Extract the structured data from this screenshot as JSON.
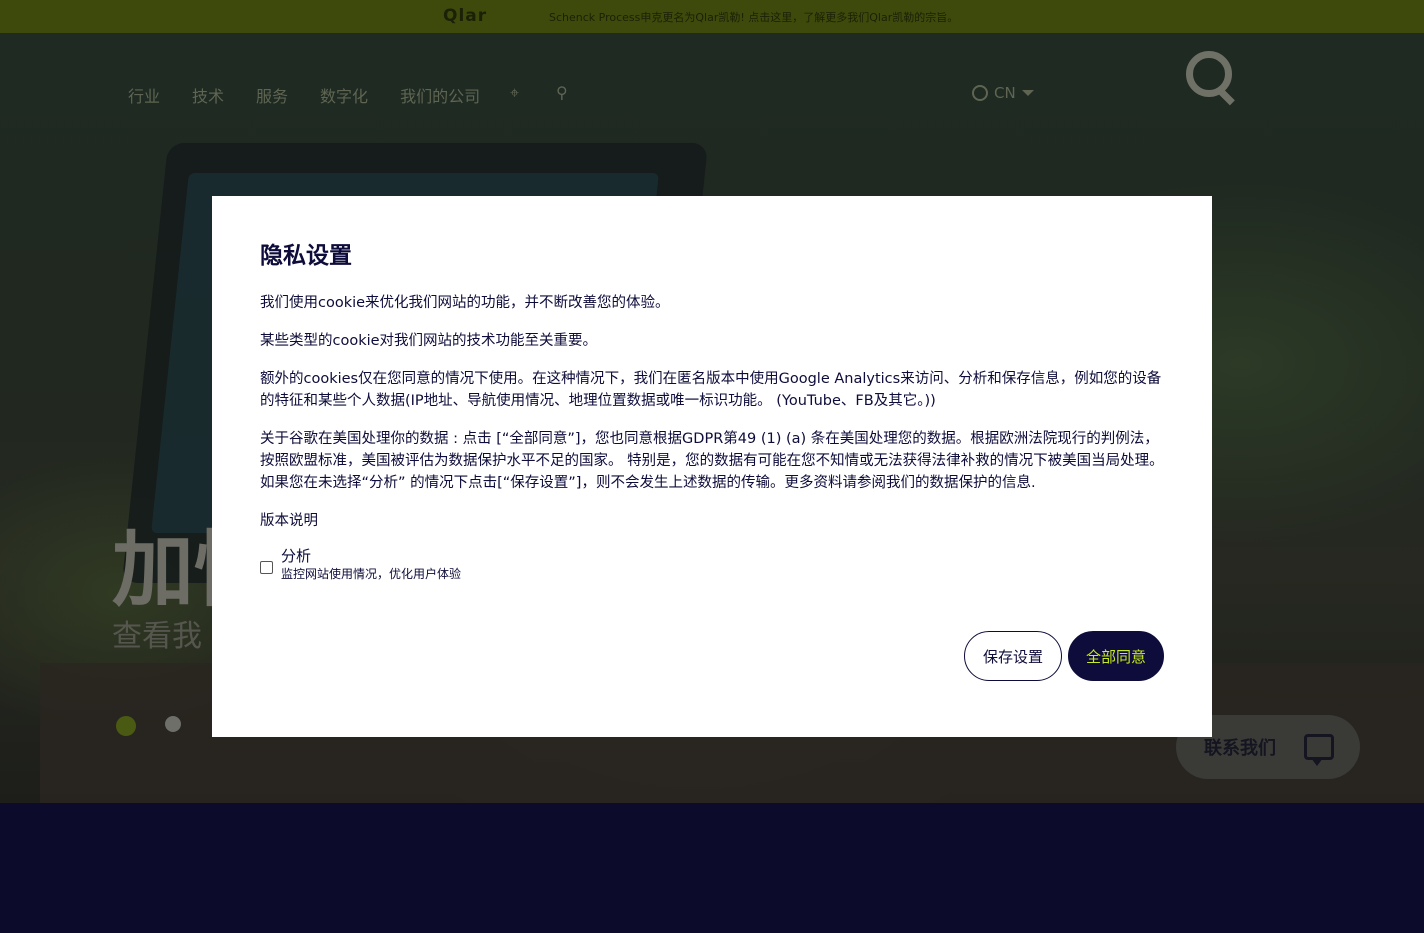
{
  "topbar": {
    "brand": "Qlar",
    "message": "Schenck Process申克更名为Qlar凯勒! 点击这里，了解更多我们Qlar凯勒的宗旨。"
  },
  "nav": {
    "items": [
      "行业",
      "技术",
      "服务",
      "数字化",
      "我们的公司"
    ],
    "location_icon": "location-pin-icon",
    "search_icon": "search-icon",
    "language": "CN"
  },
  "hero": {
    "title": "加快",
    "subtitle": "查看我"
  },
  "contact": {
    "label": "联系我们",
    "icon": "chat-icon"
  },
  "modal": {
    "title": "隐私设置",
    "paragraphs": [
      "我们使用cookie来优化我们网站的功能，并不断改善您的体验。",
      "某些类型的cookie对我们网站的技术功能至关重要。",
      "额外的cookies仅在您同意的情况下使用。在这种情况下，我们在匿名版本中使用Google Analytics来访问、分析和保存信息，例如您的设备的特征和某些个人数据(IP地址、导航使用情况、地理位置数据或唯一标识功能。 (YouTube、FB及其它。))",
      "关于谷歌在美国处理你的数据 : 点击 [“全部同意”]，您也同意根据GDPR第49 (1) (a) 条在美国处理您的数据。根据欧洲法院现行的判例法，按照欧盟标准，美国被评估为数据保护水平不足的国家。 特别是，您的数据有可能在您不知情或无法获得法律补救的情况下被美国当局处理。如果您在未选择“分析” 的情况下点击[“保存设置”]，则不会发生上述数据的传输。更多资料请参阅我们的数据保护的信息."
    ],
    "edition_link": "版本说明",
    "analytics": {
      "label": "分析",
      "description": "监控网站使用情况，优化用户体验",
      "checked": false
    },
    "buttons": {
      "save": "保存设置",
      "accept_all": "全部同意"
    }
  }
}
